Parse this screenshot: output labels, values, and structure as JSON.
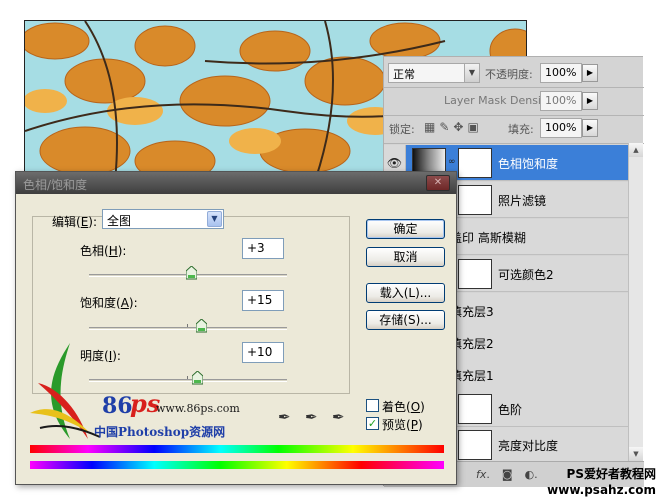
{
  "layers_panel": {
    "blend_mode": "正常",
    "opacity_label": "不透明度:",
    "opacity_value": "100%",
    "mask_density_label": "Layer Mask Density",
    "mask_density_value": "100%",
    "lock_label": "锁定:",
    "fill_label": "填充:",
    "fill_value": "100%",
    "layers": [
      {
        "name": "色相饱和度",
        "selected": true
      },
      {
        "name": "照片滤镜",
        "selected": false
      },
      {
        "name": "盖印 高斯模糊",
        "selected": false
      },
      {
        "name": "可选颜色2",
        "selected": false
      },
      {
        "name": "填充层3",
        "selected": false
      },
      {
        "name": "填充层2",
        "selected": false
      },
      {
        "name": "填充层1",
        "selected": false
      },
      {
        "name": "色阶",
        "selected": false
      },
      {
        "name": "亮度对比度",
        "selected": false
      }
    ],
    "bottom_icons": [
      "fx-icon",
      "mask-icon",
      "adjustment-icon"
    ]
  },
  "dialog": {
    "title": "色相/饱和度",
    "close_glyph": "✕",
    "edit_label": "编辑(",
    "edit_key": "E",
    "edit_suffix": "):",
    "edit_value": "全图",
    "hue_label": "色相(",
    "hue_key": "H",
    "hue_suffix": "):",
    "hue_value": "+3",
    "saturation_label": "饱和度(",
    "saturation_key": "A",
    "saturation_suffix": "):",
    "saturation_value": "+15",
    "lightness_label": "明度(",
    "lightness_key": "I",
    "lightness_suffix": "):",
    "lightness_value": "+10",
    "ok_label": "确定",
    "cancel_label": "取消",
    "load_label": "载入(L)...",
    "save_label": "存储(S)...",
    "colorize_label": "着色(",
    "colorize_key": "O",
    "colorize_suffix": ")",
    "colorize_checked": false,
    "preview_label": "预览(",
    "preview_key": "P",
    "preview_suffix": ")",
    "preview_checked": true
  },
  "watermarks": {
    "logo_number": "86",
    "logo_letters": "ps",
    "logo_url": "www.86ps.com",
    "logo_caption": "中国Photoshop资源网",
    "site_name": "PS爱好者教程网",
    "site_url": "www.psahz.com"
  }
}
